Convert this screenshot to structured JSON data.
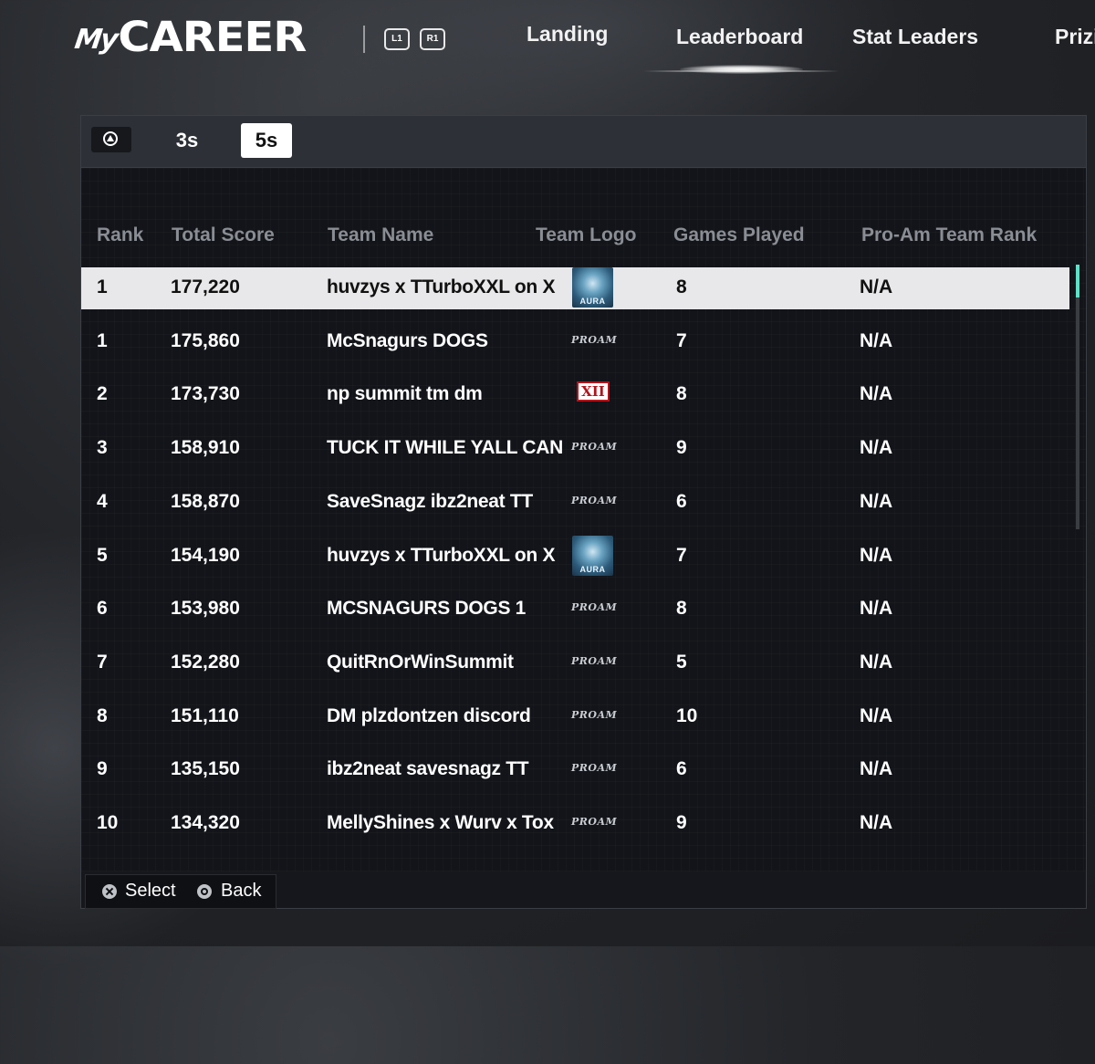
{
  "logo": {
    "my": "My",
    "career": "CAREER"
  },
  "shoulder_buttons": {
    "left": "L1",
    "right": "R1"
  },
  "nav": {
    "items": [
      {
        "label": "Landing"
      },
      {
        "label": "Leaderboard"
      },
      {
        "label": "Stat Leaders"
      },
      {
        "label": "Prizi"
      }
    ],
    "active": "Leaderboard"
  },
  "mode_tabs": {
    "items": [
      {
        "label": "3s"
      },
      {
        "label": "5s"
      }
    ],
    "active": "5s"
  },
  "table": {
    "headers": {
      "rank": "Rank",
      "total_score": "Total Score",
      "team_name": "Team Name",
      "team_logo": "Team Logo",
      "games_played": "Games Played",
      "proam_rank": "Pro-Am Team Rank"
    },
    "rows": [
      {
        "rank": "1",
        "score": "177,220",
        "team": "huvzys x TTurboXXL on X",
        "logo": "aura-icon",
        "logo_text": "AURA",
        "games": "8",
        "proam_rank": "N/A",
        "selected": true
      },
      {
        "rank": "1",
        "score": "175,860",
        "team": "McSnagurs DOGS",
        "logo": "proam-icon",
        "logo_text": "PROAM",
        "games": "7",
        "proam_rank": "N/A"
      },
      {
        "rank": "2",
        "score": "173,730",
        "team": "np summit tm dm",
        "logo": "xii-icon",
        "logo_text": "XII",
        "games": "8",
        "proam_rank": "N/A"
      },
      {
        "rank": "3",
        "score": "158,910",
        "team": "TUCK IT WHILE YALL CAN",
        "logo": "proam-icon",
        "logo_text": "PROAM",
        "games": "9",
        "proam_rank": "N/A"
      },
      {
        "rank": "4",
        "score": "158,870",
        "team": "SaveSnagz ibz2neat TT",
        "logo": "proam-icon",
        "logo_text": "PROAM",
        "games": "6",
        "proam_rank": "N/A"
      },
      {
        "rank": "5",
        "score": "154,190",
        "team": "huvzys x TTurboXXL on X",
        "logo": "aura-icon",
        "logo_text": "AURA",
        "games": "7",
        "proam_rank": "N/A"
      },
      {
        "rank": "6",
        "score": "153,980",
        "team": "MCSNAGURS DOGS 1",
        "logo": "proam-icon",
        "logo_text": "PROAM",
        "games": "8",
        "proam_rank": "N/A"
      },
      {
        "rank": "7",
        "score": "152,280",
        "team": "QuitRnOrWinSummit",
        "logo": "proam-icon",
        "logo_text": "PROAM",
        "games": "5",
        "proam_rank": "N/A"
      },
      {
        "rank": "8",
        "score": "151,110",
        "team": "DM plzdontzen discord",
        "logo": "proam-icon",
        "logo_text": "PROAM",
        "games": "10",
        "proam_rank": "N/A"
      },
      {
        "rank": "9",
        "score": "135,150",
        "team": "ibz2neat savesnagz TT",
        "logo": "proam-icon",
        "logo_text": "PROAM",
        "games": "6",
        "proam_rank": "N/A"
      },
      {
        "rank": "10",
        "score": "134,320",
        "team": "MellyShines x Wurv x Tox",
        "logo": "proam-icon",
        "logo_text": "PROAM",
        "games": "9",
        "proam_rank": "N/A"
      }
    ]
  },
  "footer": {
    "select": "Select",
    "back": "Back"
  },
  "colors": {
    "accent_scroll": "#5fe0c8",
    "selected_row": "#e8e8ea",
    "xii_red": "#b3151c"
  }
}
